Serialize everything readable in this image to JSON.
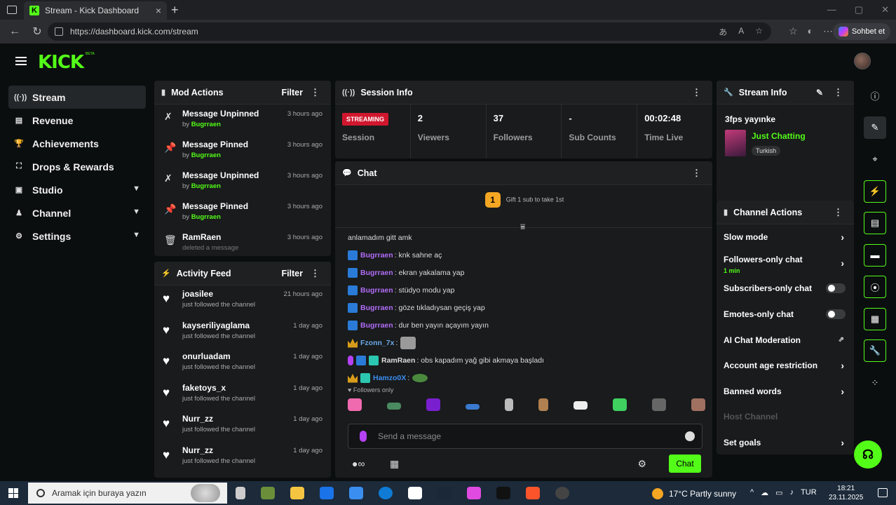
{
  "browser": {
    "tab_title": "Stream - Kick Dashboard",
    "tab_favicon": "K",
    "url": "https://dashboard.kick.com/stream",
    "copilot_label": "Sohbet et"
  },
  "app": {
    "logo": "KICK",
    "logo_badge": "BETA",
    "accent": "#53fc18"
  },
  "sidebar": {
    "items": [
      {
        "label": "Stream",
        "icon": "stream-icon",
        "glyph": "((·))"
      },
      {
        "label": "Revenue",
        "icon": "revenue-icon",
        "glyph": "▤"
      },
      {
        "label": "Achievements",
        "icon": "trophy-icon",
        "glyph": "🏆"
      },
      {
        "label": "Drops & Rewards",
        "icon": "drops-icon",
        "glyph": "⛶"
      },
      {
        "label": "Studio",
        "icon": "studio-icon",
        "glyph": "▣"
      },
      {
        "label": "Channel",
        "icon": "channel-icon",
        "glyph": "♟"
      },
      {
        "label": "Settings",
        "icon": "gear-icon",
        "glyph": "⚙"
      }
    ]
  },
  "mod_actions": {
    "title": "Mod Actions",
    "filter": "Filter",
    "items": [
      {
        "action": "Message Unpinned",
        "by_prefix": "by",
        "by": "Bugrraen",
        "time": "3 hours ago",
        "glyph": "✗"
      },
      {
        "action": "Message Pinned",
        "by_prefix": "by",
        "by": "Bugrraen",
        "time": "3 hours ago",
        "glyph": "📌"
      },
      {
        "action": "Message Unpinned",
        "by_prefix": "by",
        "by": "Bugrraen",
        "time": "3 hours ago",
        "glyph": "✗"
      },
      {
        "action": "Message Pinned",
        "by_prefix": "by",
        "by": "Bugrraen",
        "time": "3 hours ago",
        "glyph": "📌"
      },
      {
        "action": "RamRaen",
        "by_prefix": "",
        "by": "deleted a message",
        "time": "3 hours ago",
        "glyph": "🗑"
      }
    ]
  },
  "activity_feed": {
    "title": "Activity Feed",
    "filter": "Filter",
    "items": [
      {
        "user": "joasilee",
        "text": "just followed the channel",
        "time": "21 hours ago"
      },
      {
        "user": "kayseriliyaglama",
        "text": "just followed the channel",
        "time": "1 day ago"
      },
      {
        "user": "onurluadam",
        "text": "just followed the channel",
        "time": "1 day ago"
      },
      {
        "user": "faketoys_x",
        "text": "just followed the channel",
        "time": "1 day ago"
      },
      {
        "user": "Nurr_zz",
        "text": "just followed the channel",
        "time": "1 day ago"
      },
      {
        "user": "Nurr_zz",
        "text": "just followed the channel",
        "time": "1 day ago"
      }
    ]
  },
  "session_info": {
    "title": "Session Info",
    "status_badge": "STREAMING",
    "status_color": "#d1172e",
    "cells": [
      {
        "value": "",
        "label": "Session"
      },
      {
        "value": "2",
        "label": "Viewers"
      },
      {
        "value": "37",
        "label": "Followers"
      },
      {
        "value": "-",
        "label": "Sub Counts"
      },
      {
        "value": "00:02:48",
        "label": "Time Live"
      }
    ]
  },
  "chat": {
    "title": "Chat",
    "gift_badge": "1",
    "gift_text": "Gift 1 sub to take 1st",
    "messages": [
      {
        "badges": [],
        "user": "",
        "color": "#ddd",
        "text": "anlamadım gitt amk",
        "emote": ""
      },
      {
        "badges": [
          "mod"
        ],
        "user": "Bugrraen",
        "color": "#b06cf7",
        "text": ": knk sahne aç",
        "emote": ""
      },
      {
        "badges": [
          "mod"
        ],
        "user": "Bugrraen",
        "color": "#b06cf7",
        "text": ": ekran yakalama yap",
        "emote": ""
      },
      {
        "badges": [
          "mod"
        ],
        "user": "Bugrraen",
        "color": "#b06cf7",
        "text": ": stüdyo modu yap",
        "emote": ""
      },
      {
        "badges": [
          "mod"
        ],
        "user": "Bugrraen",
        "color": "#b06cf7",
        "text": ": göze tıkladıysan geçiş yap",
        "emote": ""
      },
      {
        "badges": [
          "mod"
        ],
        "user": "Bugrraen",
        "color": "#b06cf7",
        "text": ": dur ben yayın açayım yayın",
        "emote": ""
      },
      {
        "badges": [
          "crown"
        ],
        "user": "Fzonn_7x",
        "color": "#6aa8e8",
        "text": ":",
        "emote": "cat"
      },
      {
        "badges": [
          "mic",
          "mod",
          "sub"
        ],
        "user": "RamRaen",
        "color": "#dddddd",
        "text": ": obs kapadım yağ gibi akmaya başladı",
        "emote": ""
      },
      {
        "badges": [
          "crown",
          "sub"
        ],
        "user": "Hamzo0X",
        "color": "#3b8df0",
        "text": ":",
        "emote": "frog"
      }
    ],
    "followers_only": "Followers only",
    "input_placeholder": "Send a message",
    "send_button": "Chat"
  },
  "stream_info": {
    "title": "Stream Info",
    "stream_title": "3fps yayınke",
    "category": "Just Chatting",
    "tag": "Turkish"
  },
  "channel_actions": {
    "title": "Channel Actions",
    "items": [
      {
        "label": "Slow mode",
        "control": "arrow",
        "sub": ""
      },
      {
        "label": "Followers-only chat",
        "control": "arrow",
        "sub": "1 min"
      },
      {
        "label": "Subscribers-only chat",
        "control": "toggle",
        "sub": ""
      },
      {
        "label": "Emotes-only chat",
        "control": "toggle",
        "sub": ""
      },
      {
        "label": "AI Chat Moderation",
        "control": "external",
        "sub": ""
      },
      {
        "label": "Account age restriction",
        "control": "arrow",
        "sub": ""
      },
      {
        "label": "Banned words",
        "control": "arrow",
        "sub": ""
      },
      {
        "label": "Host Channel",
        "control": "disabled",
        "sub": ""
      },
      {
        "label": "Set goals",
        "control": "arrow",
        "sub": ""
      }
    ]
  },
  "right_rail": {
    "icons": [
      "info-icon",
      "pencil-icon",
      "crosshair-icon",
      "bolt-icon",
      "notes-icon",
      "chat-bubble-icon",
      "broadcast-icon",
      "layout-icon",
      "wrench-icon",
      "apps-icon"
    ]
  },
  "taskbar": {
    "search_placeholder": "Aramak için buraya yazın",
    "weather": "17°C  Partly sunny",
    "lang": "TUR",
    "time": "18:21",
    "date": "23.11.2025"
  }
}
